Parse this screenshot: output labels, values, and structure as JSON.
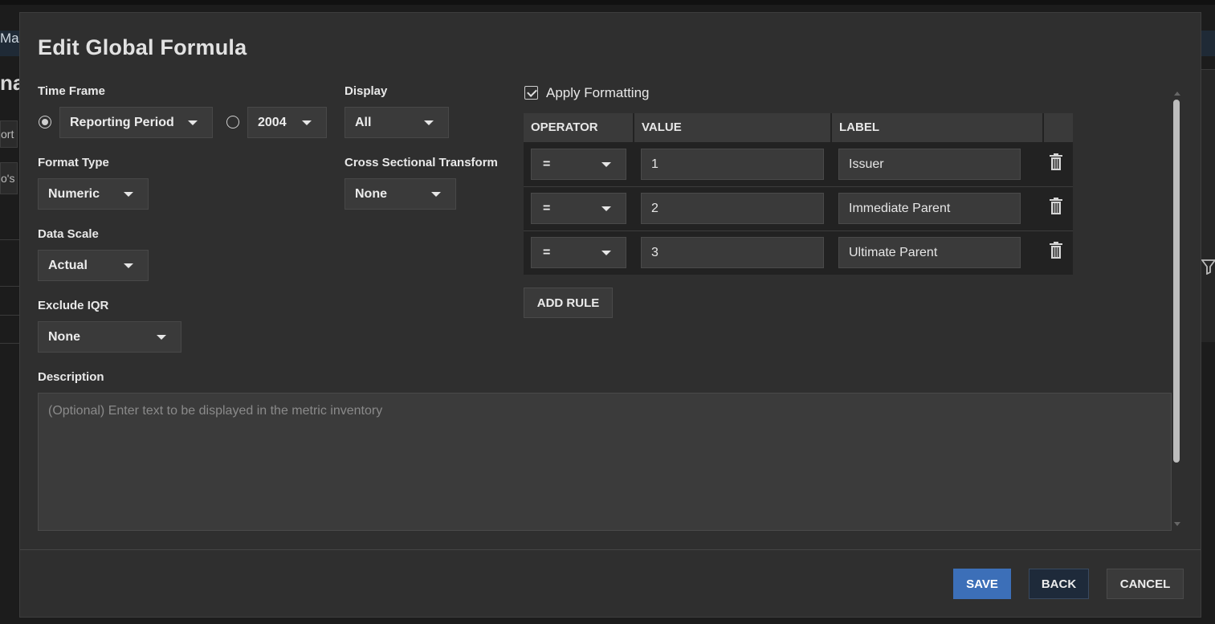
{
  "background": {
    "strip_text": "Ma",
    "heading_text": "na",
    "field1_text": "ort",
    "field2_text": "o's"
  },
  "modal": {
    "title": "Edit Global Formula"
  },
  "time_frame": {
    "label": "Time Frame",
    "option1": "Reporting Period",
    "option2": "2004",
    "selected": "option1"
  },
  "display": {
    "label": "Display",
    "value": "All"
  },
  "format_type": {
    "label": "Format Type",
    "value": "Numeric"
  },
  "cross_sectional": {
    "label": "Cross Sectional Transform",
    "value": "None"
  },
  "data_scale": {
    "label": "Data Scale",
    "value": "Actual"
  },
  "exclude_iqr": {
    "label": "Exclude IQR",
    "value": "None"
  },
  "formatting": {
    "apply_label": "Apply Formatting",
    "checked": true,
    "columns": [
      "OPERATOR",
      "VALUE",
      "LABEL"
    ],
    "rules": [
      {
        "operator": "=",
        "value": "1",
        "label": "Issuer"
      },
      {
        "operator": "=",
        "value": "2",
        "label": "Immediate Parent"
      },
      {
        "operator": "=",
        "value": "3",
        "label": "Ultimate Parent"
      }
    ],
    "add_rule_label": "ADD RULE"
  },
  "description": {
    "label": "Description",
    "placeholder": "(Optional) Enter text to be displayed in the metric inventory"
  },
  "footer": {
    "save_label": "SAVE",
    "back_label": "BACK",
    "cancel_label": "CANCEL"
  },
  "colors": {
    "primary": "#3c6fb8",
    "modal_bg": "#2f2f2f"
  }
}
